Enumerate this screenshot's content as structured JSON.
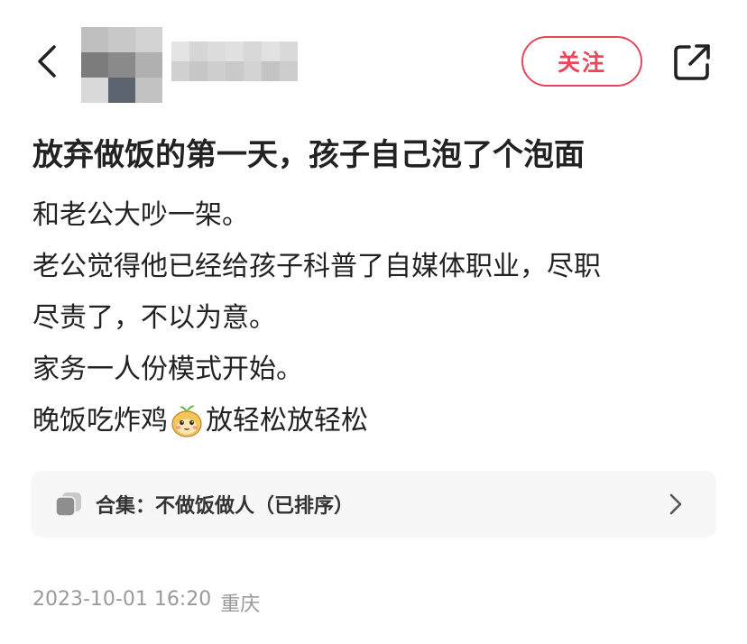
{
  "header": {
    "follow_label": "关注",
    "back_icon": "chevron-left-icon",
    "share_icon": "share-icon",
    "accent_color": "#e8465a"
  },
  "post": {
    "title": "放弃做饭的第一天，孩子自己泡了个泡面",
    "lines": [
      "和老公大吵一架。",
      "老公觉得他已经给孩子科普了自媒体职业，尽职",
      "尽责了，不以为意。",
      "家务一人份模式开始。"
    ],
    "last_line_before_emoji": "晚饭吃炸鸡",
    "emoji_icon": "blushing-sticker-icon",
    "last_line_after_emoji": "放轻松放轻松"
  },
  "collection": {
    "label": "合集：不做饭做人（已排序）",
    "icon": "collection-stack-icon"
  },
  "meta": {
    "datetime": "2023-10-01 16:20",
    "location": "重庆"
  }
}
